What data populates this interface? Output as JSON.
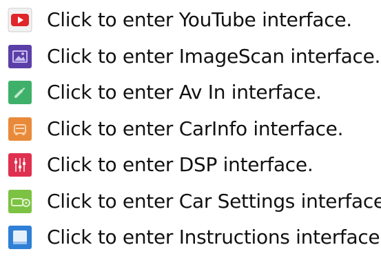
{
  "items": [
    {
      "icon": "youtube-icon",
      "color": "#e0262b",
      "label": "Click to enter YouTube interface."
    },
    {
      "icon": "image-scan-icon",
      "color": "#5b3fa8",
      "label": "Click to enter ImageScan interface."
    },
    {
      "icon": "av-in-icon",
      "color": "#3fb06a",
      "label": "Click to enter Av In interface."
    },
    {
      "icon": "car-info-icon",
      "color": "#e98a3a",
      "label": "Click to enter CarInfo interface."
    },
    {
      "icon": "dsp-icon",
      "color": "#e0304f",
      "label": "Click to enter DSP interface."
    },
    {
      "icon": "car-settings-icon",
      "color": "#7cc243",
      "label": "Click to enter Car Settings interface."
    },
    {
      "icon": "instructions-icon",
      "color": "#2f7fd6",
      "label": "Click to enter Instructions interface."
    }
  ]
}
